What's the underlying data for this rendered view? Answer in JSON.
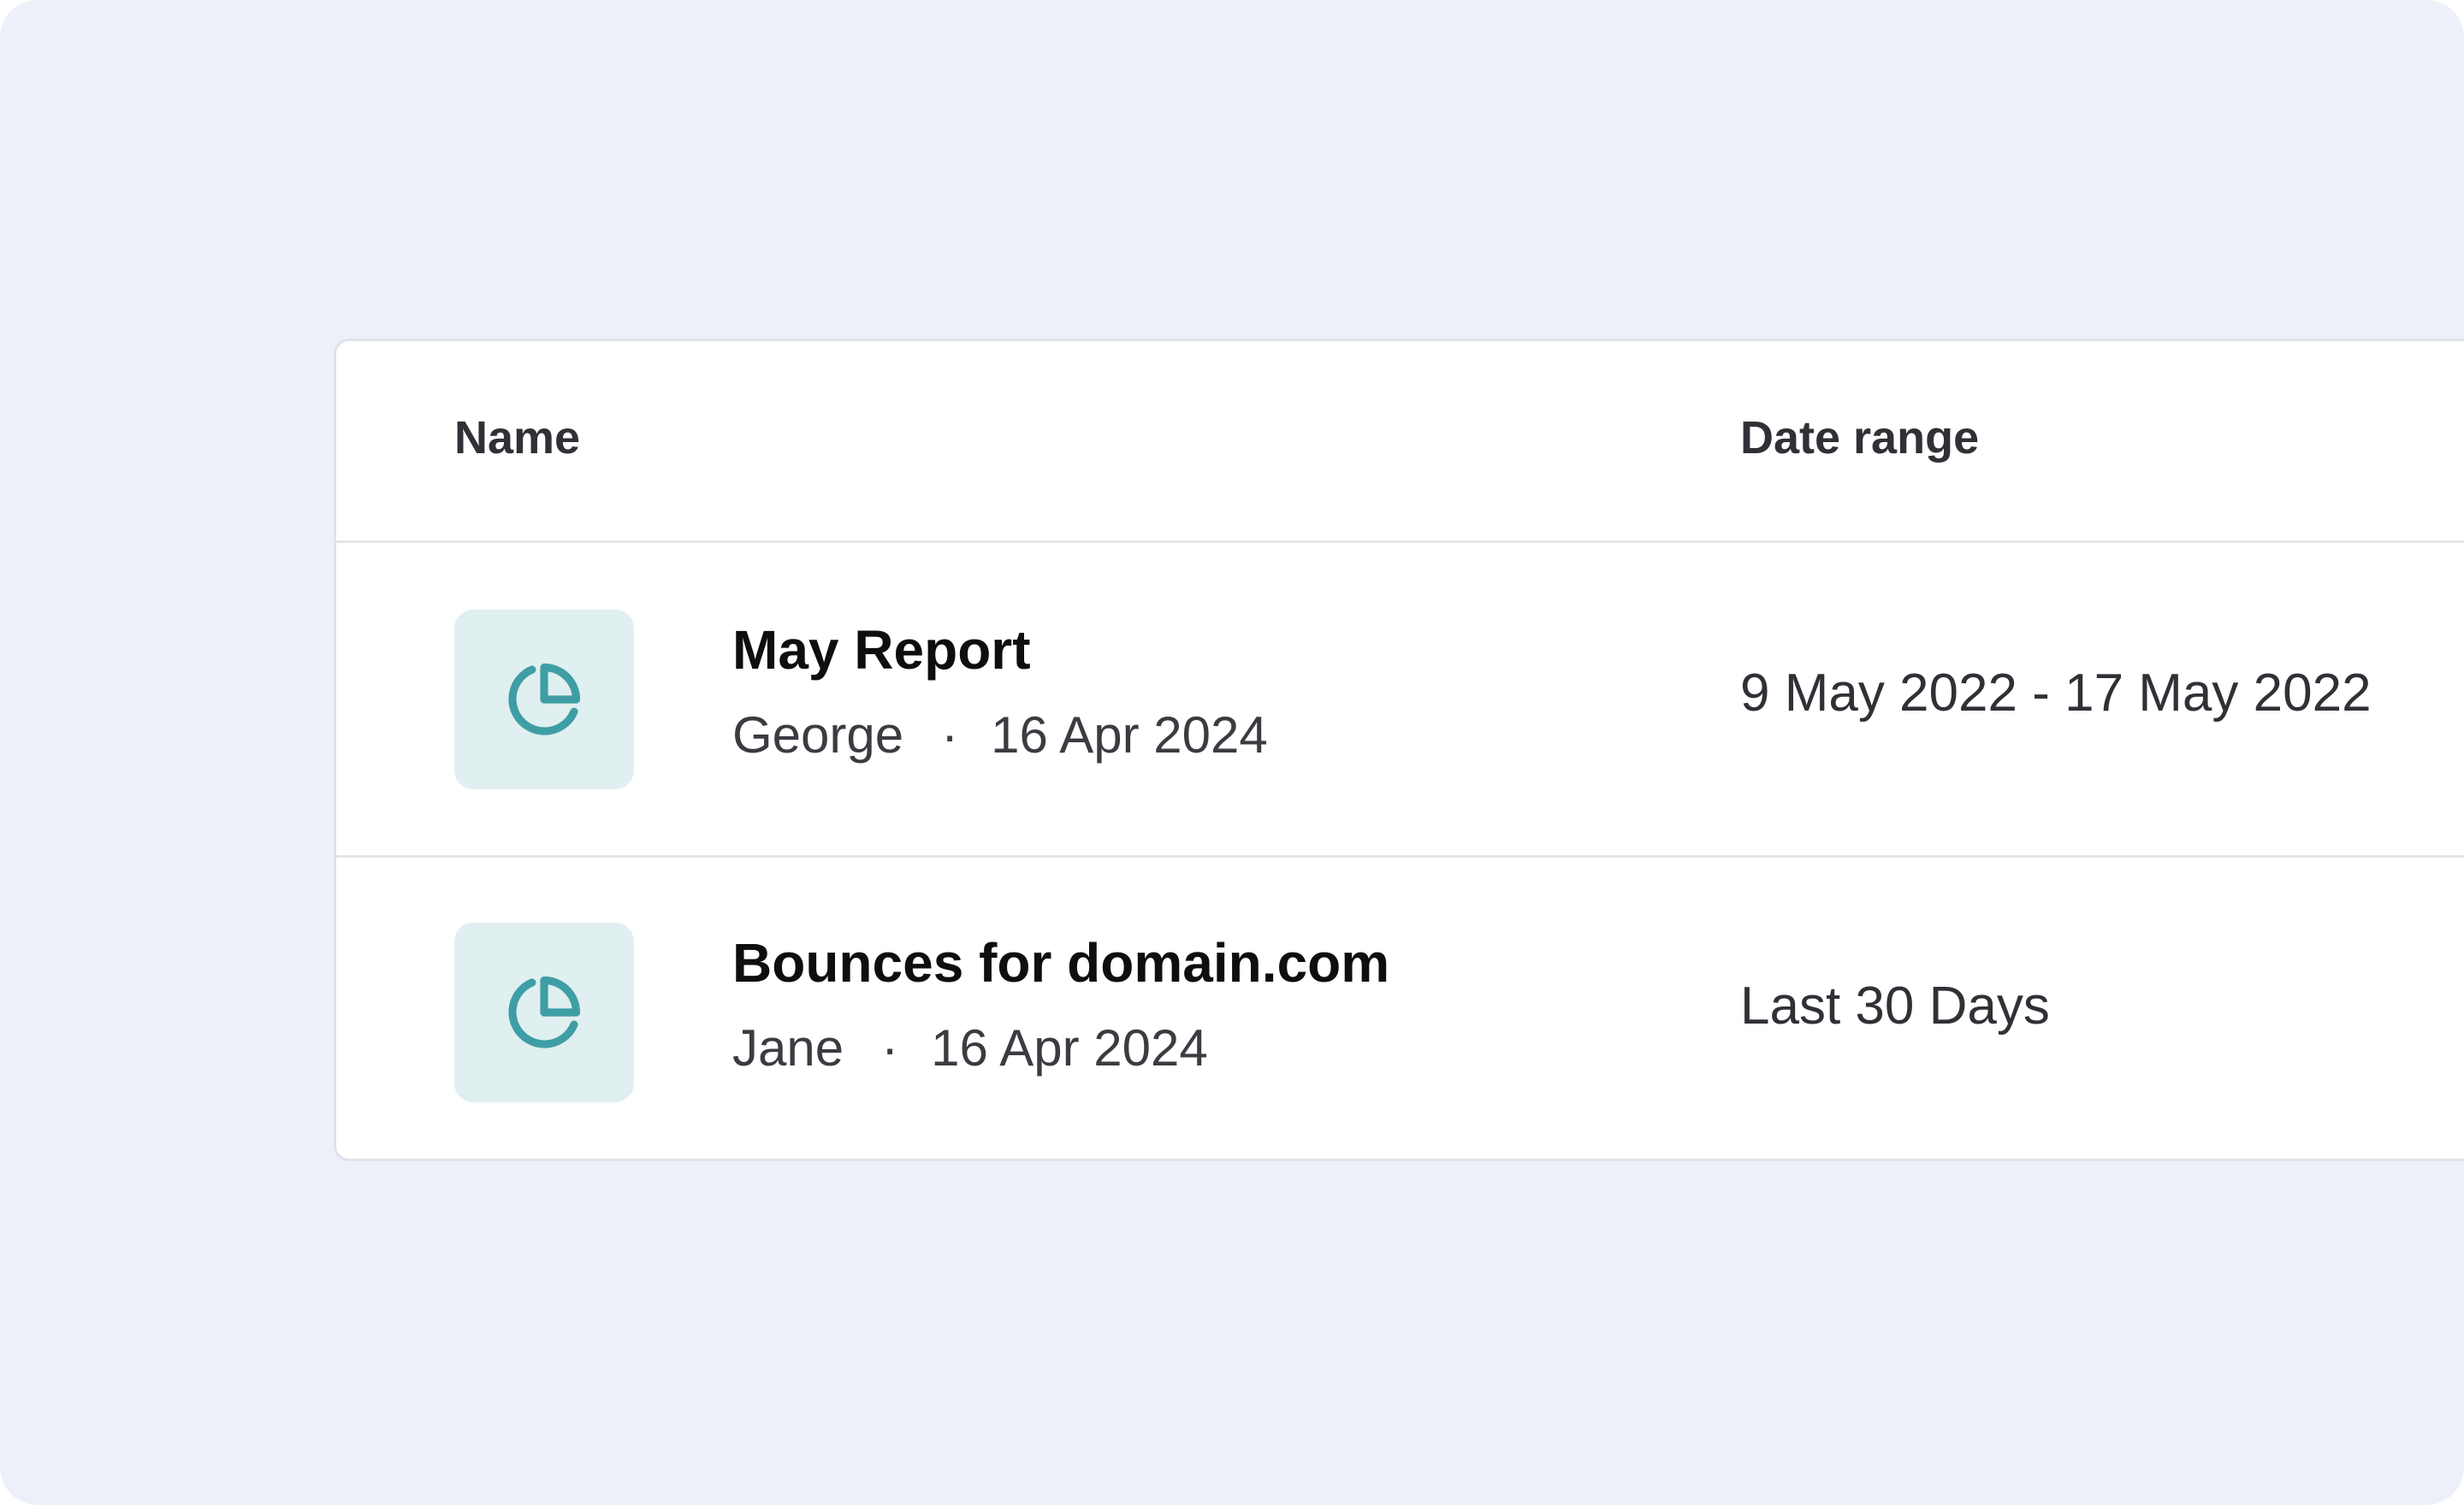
{
  "table": {
    "columns": {
      "name": "Name",
      "date_range": "Date range"
    },
    "rows": [
      {
        "icon": "pie-chart-icon",
        "title": "May Report",
        "author": "George",
        "separator": "·",
        "date": "16 Apr 2024",
        "date_range": "9 May 2022 - 17 May 2022"
      },
      {
        "icon": "pie-chart-icon",
        "title": "Bounces for domain.com",
        "author": "Jane",
        "separator": "·",
        "date": "16 Apr 2024",
        "date_range": "Last 30 Days"
      }
    ]
  },
  "colors": {
    "background": "#edf0f8",
    "icon_tile": "#e0efef",
    "icon_accent": "#3f9ea5"
  }
}
